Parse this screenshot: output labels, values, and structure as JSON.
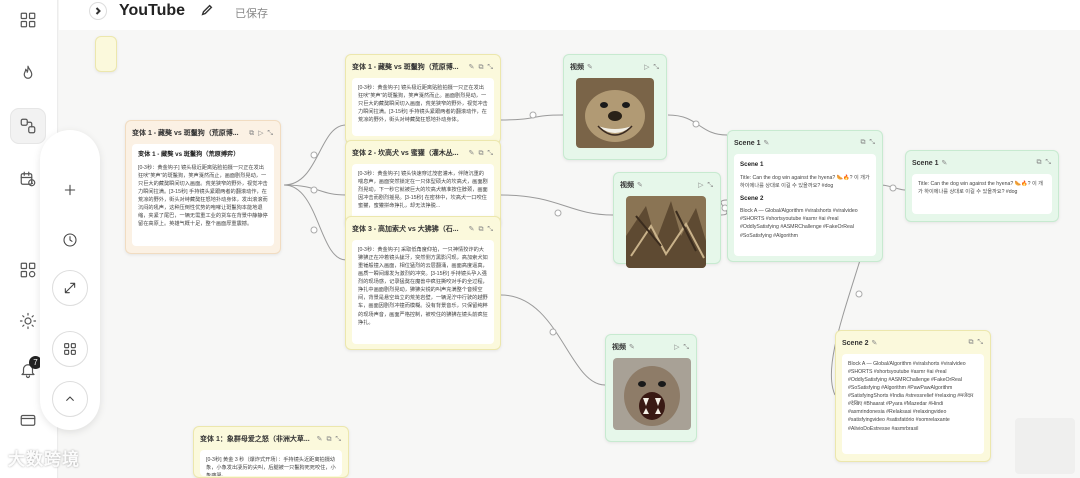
{
  "header": {
    "title": "YouTube",
    "status": "已保存"
  },
  "rail": {
    "notification_count": "7"
  },
  "nodes": {
    "left_variant": {
      "title": "变体 1 - 藏獒 vs 斑鬣狗（荒原博...",
      "subtitle": "变体 1 - 藏獒 vs 斑鬣狗（荒原搏弈）",
      "body": "[0-3秒：黄金钩子] 镜头极近距离贴脸拍摄一只正在发出狂吠\"笑声\"的斑鬣狗，笑声戛然而止，画面剧烈晃动，一只巨大的藏獒瞬间切入画面。荒芜狭窄的野外，视觉冲击力瞬间拉满。[3-15秒] 手持镜头紧跟两者的翻滚动作，在荒凉的野外，街头对峙藏獒狂怒地扑动身体，发出滚滚而沉闷的吼声，这种压倒性优势的咆哮让斑鬣狗本能地退缩，夹紧了尾巴，一辆无需重工业的货车在背景中静静停留在高原上。英雄气概十足，整个画面厚重震撼。"
    },
    "variant1": {
      "title": "变体 1 - 藏獒 vs 斑鬣狗（荒原博...",
      "body": "[0-3秒：黄金钩子] 镜头极近距离贴脸拍摄一只正在发出狂吠\"笑声\"的斑鬣狗，笑声戛然而止。画面剧烈晃动，一只巨大的藏獒瞬间切入画面，荒芜狭窄的野外，视觉冲击力瞬间拉满。[3-15秒] 手持镜头紧跟两者的翻滚动作，在荒凉的野外，街头对峙藏獒狂怒地扑动身体。"
    },
    "variant2": {
      "title": "变体 2 - 坎高犬 vs 蜜獾（灌木丛...",
      "body": "[0-3秒：黄金钩子] 镜头快速穿过茂密灌木，伴随沉重的喘息声，画面突然锁定在一只体型硕大的坎高犬，画面剧烈晃动，下一秒它就被巨大的坎高犬精准按住脖颈，画面因冲击而剧烈摇晃。[3-15秒] 在密林中，坎高犬一口咬住蜜獾，蜜獾拼命挣扎，却无法挣脱..."
    },
    "variant3": {
      "title": "变体 3 - 高加索犬 vs 大狒狒（石...",
      "body": "[0-3秒：黄金钩子] 采取低角度仰拍，一只神情狡诈的大狒狒正在冲着镜头龇牙，突然侧方黑影闪现，高加索犬如重锤般撞入画面，相位猛烈的云层翻涌，画面高度逼真，画质一瞬间爆发为激烈的冲突。[3-15秒] 手持镜头孕入强烈的现场感，记录猛獒在魔兽中疯狂撕咬对手的全过程，挣扎中画面剧烈晃动，狒狒尖锐的叫声充满整个音频空间，背景是悬空耸立的荒芜岩壁，一辆泥泞中行驶的越野车，画面因剧烈冲撞而模糊。没有背景音乐，只保留纯粹的现场声音，画面严格控制，被咬住的狒狒在镜头前疯狂挣扎。"
    },
    "video1": {
      "title": "视频"
    },
    "video2": {
      "title": "视频"
    },
    "video3": {
      "title": "视频"
    },
    "scene1": {
      "title": "Scene 1",
      "sub1": "Scene 1",
      "body1": "Title: Can the dog win against the hyena? 🌭🔥? 이 개가 하이에나를 상대로 이길 수 있을까요? #dog",
      "sub2": "Scene 2",
      "body2": "Block A — Global/Algorithm #viralshorts #viralvideo #SHORTS #shortsyoutube #asmr #ai #real #OddlySatisfying #ASMRChallenge #FakeOrReal #SoSatisfying #Algorithm"
    },
    "scene1_right": {
      "title": "Scene 1",
      "body": "Title: Can the dog win against the hyena? 🌭🔥? 이 개가 하이에나를 상대로 이길 수 있을까요? #dog"
    },
    "scene2": {
      "title": "Scene 2",
      "body": "Block A — Global/Algorithm #viralshorts #viralvideo #SHORTS #shortsyoutube #asmr #ai #real #OddlySatisfying #ASMRChallenge #FakeOrReal #SoSatisfying #Algorithm #PawPawAlgorithm #SatisfyingShorts #India #stressrelief #relaxing #मजेदार #देखिए #Bhaarat #Pyara #Mazedar #Hindi #asmrindonesia #Relaksasi #relaxingvideo #satisfyingvideo #satisfatório #somrelaxante #AlivioDoEstresse #asmrbrasil"
    },
    "variant_bottom": {
      "title": "变体 1：象群母爱之怒（非洲大草...",
      "body": "[0-3秒] 黄金 3 秒（爆炸式开场）：手持镜头近距离拍摄幼象，小象发出凄厉的尖叫，后腿被一只鬣狗死死咬住，小象痛哭。"
    }
  },
  "watermark": "大数跨境"
}
